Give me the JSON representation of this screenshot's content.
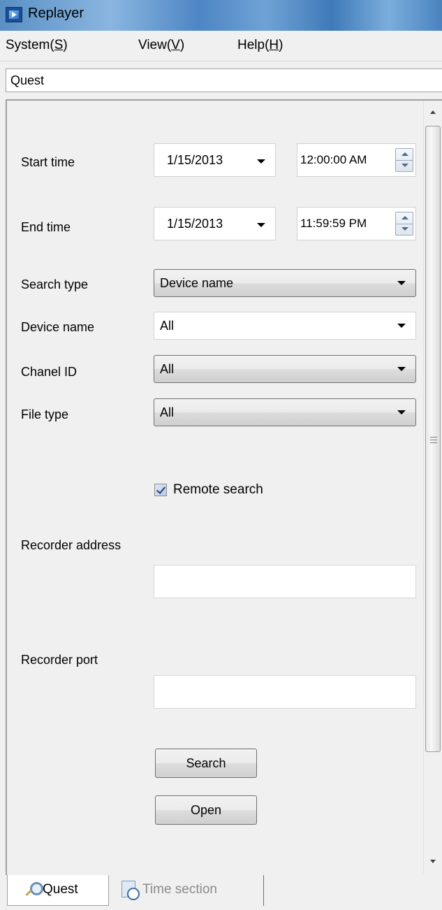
{
  "window": {
    "title": "Replayer",
    "icon": "play-media-icon"
  },
  "menu": {
    "system": {
      "label": "System(",
      "key": "S",
      "end": ")"
    },
    "view": {
      "label": "View(",
      "key": "V",
      "end": ")"
    },
    "help": {
      "label": "Help(",
      "key": "H",
      "end": ")"
    }
  },
  "pane": {
    "title": "Quest"
  },
  "form": {
    "start_time": {
      "label": "Start time",
      "date": "1/15/2013",
      "time": "12:00:00 AM"
    },
    "end_time": {
      "label": "End time",
      "date": "1/15/2013",
      "time": "11:59:59 PM"
    },
    "search_type": {
      "label": "Search type",
      "value": "Device name"
    },
    "device_name": {
      "label": "Device name",
      "value": "All"
    },
    "channel_id": {
      "label": "Chanel ID",
      "value": "All"
    },
    "file_type": {
      "label": "File type",
      "value": "All"
    },
    "remote_search": {
      "label": "Remote search",
      "checked": true
    },
    "recorder_address": {
      "label": "Recorder address",
      "value": ""
    },
    "recorder_port": {
      "label": "Recorder port",
      "value": ""
    },
    "search_button": "Search",
    "open_button": "Open"
  },
  "tabs": [
    {
      "label": "Quest",
      "icon": "magnifier-icon",
      "active": true
    },
    {
      "label": "Time section",
      "icon": "clock-icon",
      "active": false
    }
  ]
}
